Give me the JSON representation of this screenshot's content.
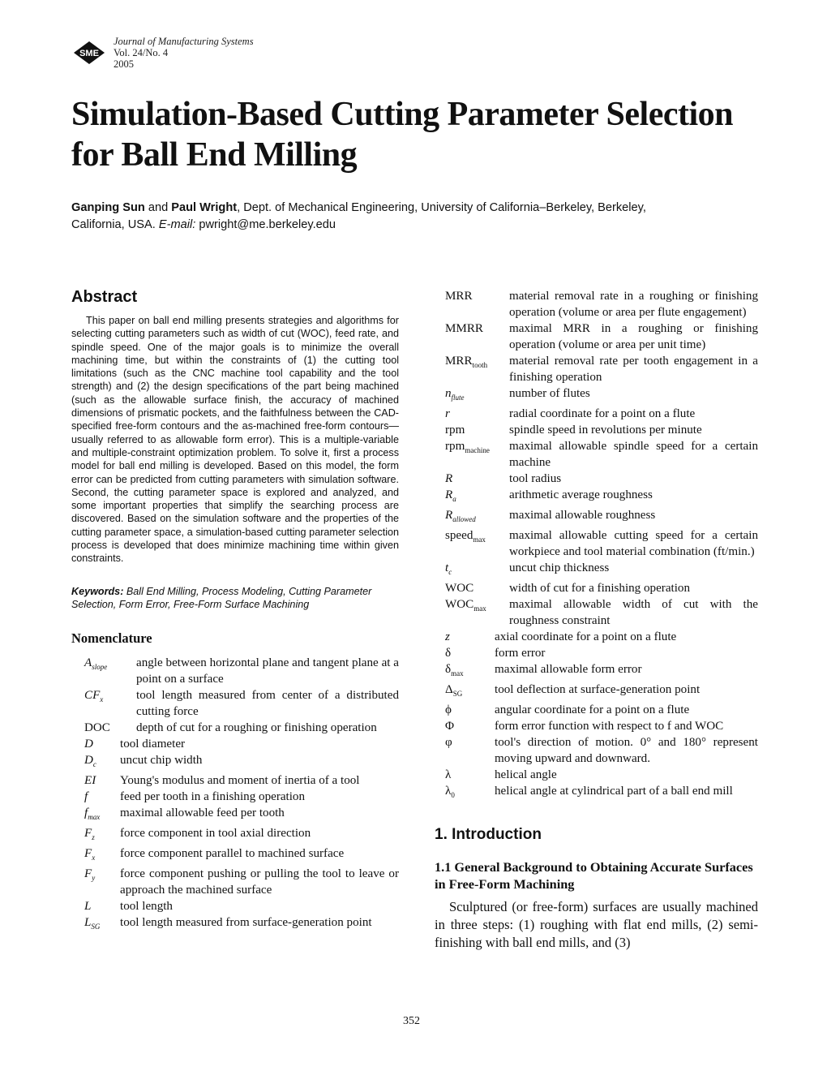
{
  "journal": {
    "logo_text": "SME",
    "name": "Journal of Manufacturing Systems",
    "volume": "Vol. 24/No. 4",
    "year": "2005"
  },
  "title_line1": "Simulation-Based Cutting Parameter Selection",
  "title_line2": "for Ball End Milling",
  "authors": {
    "author1": "Ganping Sun",
    "and": " and ",
    "author2": "Paul Wright",
    "affiliation": ", Dept. of Mechanical Engineering, University of California–Berkeley, Berkeley, California, USA. ",
    "email_label": "E-mail:",
    "email": " pwright@me.berkeley.edu"
  },
  "abstract": {
    "heading": "Abstract",
    "body": "This paper on ball end milling presents strategies and algorithms for selecting cutting parameters such as width of cut (WOC), feed rate, and spindle speed. One of the major goals is to minimize the overall machining time, but within the constraints of (1) the cutting tool limitations (such as the CNC machine tool capability and the tool strength) and (2) the design specifications of the part being machined (such as the allowable surface finish, the accuracy of machined dimensions of prismatic pockets, and the faithfulness between the CAD-specified free-form contours and the as-machined free-form contours—usually referred to as allowable form error). This is a multiple-variable and multiple-constraint optimization problem. To solve it, first a process model for ball end milling is developed. Based on this model, the form error can be predicted from cutting parameters with simulation software. Second, the cutting parameter space is explored and analyzed, and some important properties that simplify the searching process are discovered. Based on the simulation software and the properties of the cutting parameter space, a simulation-based cutting parameter selection process is developed that does minimize machining time within given constraints."
  },
  "keywords": {
    "label": "Keywords:",
    "text": " Ball End Milling, Process Modeling, Cutting Parameter Selection, Form Error, Free-Form Surface Machining"
  },
  "nomenclature": {
    "heading": "Nomenclature",
    "left": [
      {
        "sym": "A",
        "sub": "slope",
        "def": "angle between horizontal plane and tangent plane at a point on a surface"
      },
      {
        "sym": "CF",
        "sub": "x",
        "def": "tool length measured from center of a distributed cutting force"
      },
      {
        "sym": "DOC",
        "sub": "",
        "def": "depth of cut for a roughing or finishing operation"
      },
      {
        "sym": "D",
        "sub": "",
        "def": "tool diameter"
      },
      {
        "sym": "D",
        "sub": "c",
        "def": "uncut chip width"
      },
      {
        "sym": "EI",
        "sub": "",
        "def": "Young's modulus and moment of inertia of a tool"
      },
      {
        "sym": "f",
        "sub": "",
        "def": "feed per tooth in a finishing operation"
      },
      {
        "sym": "f",
        "sub": "max",
        "def": "maximal allowable feed per tooth"
      },
      {
        "sym": "F",
        "sub": "z",
        "def": "force component in tool axial direction"
      },
      {
        "sym": "F",
        "sub": "x",
        "def": "force component parallel to machined surface"
      },
      {
        "sym": "F",
        "sub": "y",
        "def": "force component pushing or pulling the tool to leave or approach the machined surface"
      },
      {
        "sym": "L",
        "sub": "",
        "def": "tool length"
      },
      {
        "sym": "L",
        "sub": "SG",
        "def": "tool length measured from surface-generation point"
      }
    ],
    "right": [
      {
        "sym": "MRR",
        "sub": "",
        "def": "material removal rate in a roughing or finishing operation (volume or area per flute engagement)"
      },
      {
        "sym": "MMRR",
        "sub": "",
        "def": "maximal MRR in a roughing or finishing operation (volume or area per unit time)"
      },
      {
        "sym": "MRR",
        "sub": "tooth",
        "def": "material removal rate per tooth engagement in a finishing operation"
      },
      {
        "sym": "n",
        "sub": "flute",
        "def": "number of flutes"
      },
      {
        "sym": "r",
        "sub": "",
        "def": "radial coordinate for a point on a flute"
      },
      {
        "sym": "rpm",
        "sub": "",
        "def": "spindle speed in revolutions per minute"
      },
      {
        "sym": "rpm",
        "sub": "machine",
        "def": "maximal allowable spindle speed for a certain machine"
      },
      {
        "sym": "R",
        "sub": "",
        "def": "tool radius"
      },
      {
        "sym": "R",
        "sub": "a",
        "def": "arithmetic average roughness"
      },
      {
        "sym": "R",
        "sub": "allowed",
        "def": "maximal allowable roughness"
      },
      {
        "sym": "speed",
        "sub": "max",
        "def": "maximal allowable cutting speed for a certain workpiece and tool material combination (ft/min.)"
      },
      {
        "sym": "t",
        "sub": "c",
        "def": "uncut chip thickness"
      },
      {
        "sym": "WOC",
        "sub": "",
        "def": "width of cut for a finishing operation"
      },
      {
        "sym": "WOC",
        "sub": "max",
        "def": "maximal allowable width of cut with the roughness constraint"
      },
      {
        "sym": "z",
        "sub": "",
        "def": "axial coordinate for a point on a flute"
      },
      {
        "sym": "δ",
        "sub": "",
        "def": "form error"
      },
      {
        "sym": "δ",
        "sub": "max",
        "def": "maximal allowable form error"
      },
      {
        "sym": "Δ",
        "sub": "SG",
        "def": "tool deflection at surface-generation point"
      },
      {
        "sym": "ϕ",
        "sub": "",
        "def": "angular coordinate for a point on a flute"
      },
      {
        "sym": "Φ",
        "sub": "",
        "def": "form error function with respect to f and WOC"
      },
      {
        "sym": "φ",
        "sub": "",
        "def": "tool's direction of motion. 0° and 180° represent moving upward and downward."
      },
      {
        "sym": "λ",
        "sub": "",
        "def": "helical angle"
      },
      {
        "sym": "λ",
        "sub": "0",
        "def": "helical angle at cylindrical part of a ball end mill"
      }
    ]
  },
  "introduction": {
    "heading": "1. Introduction",
    "subheading": "1.1 General Background to Obtaining Accurate Surfaces in Free-Form Machining",
    "body": "Sculptured (or free-form) surfaces are usually machined in three steps: (1) roughing with flat end mills, (2) semi-finishing with ball end mills, and (3)"
  },
  "page_number": "352"
}
